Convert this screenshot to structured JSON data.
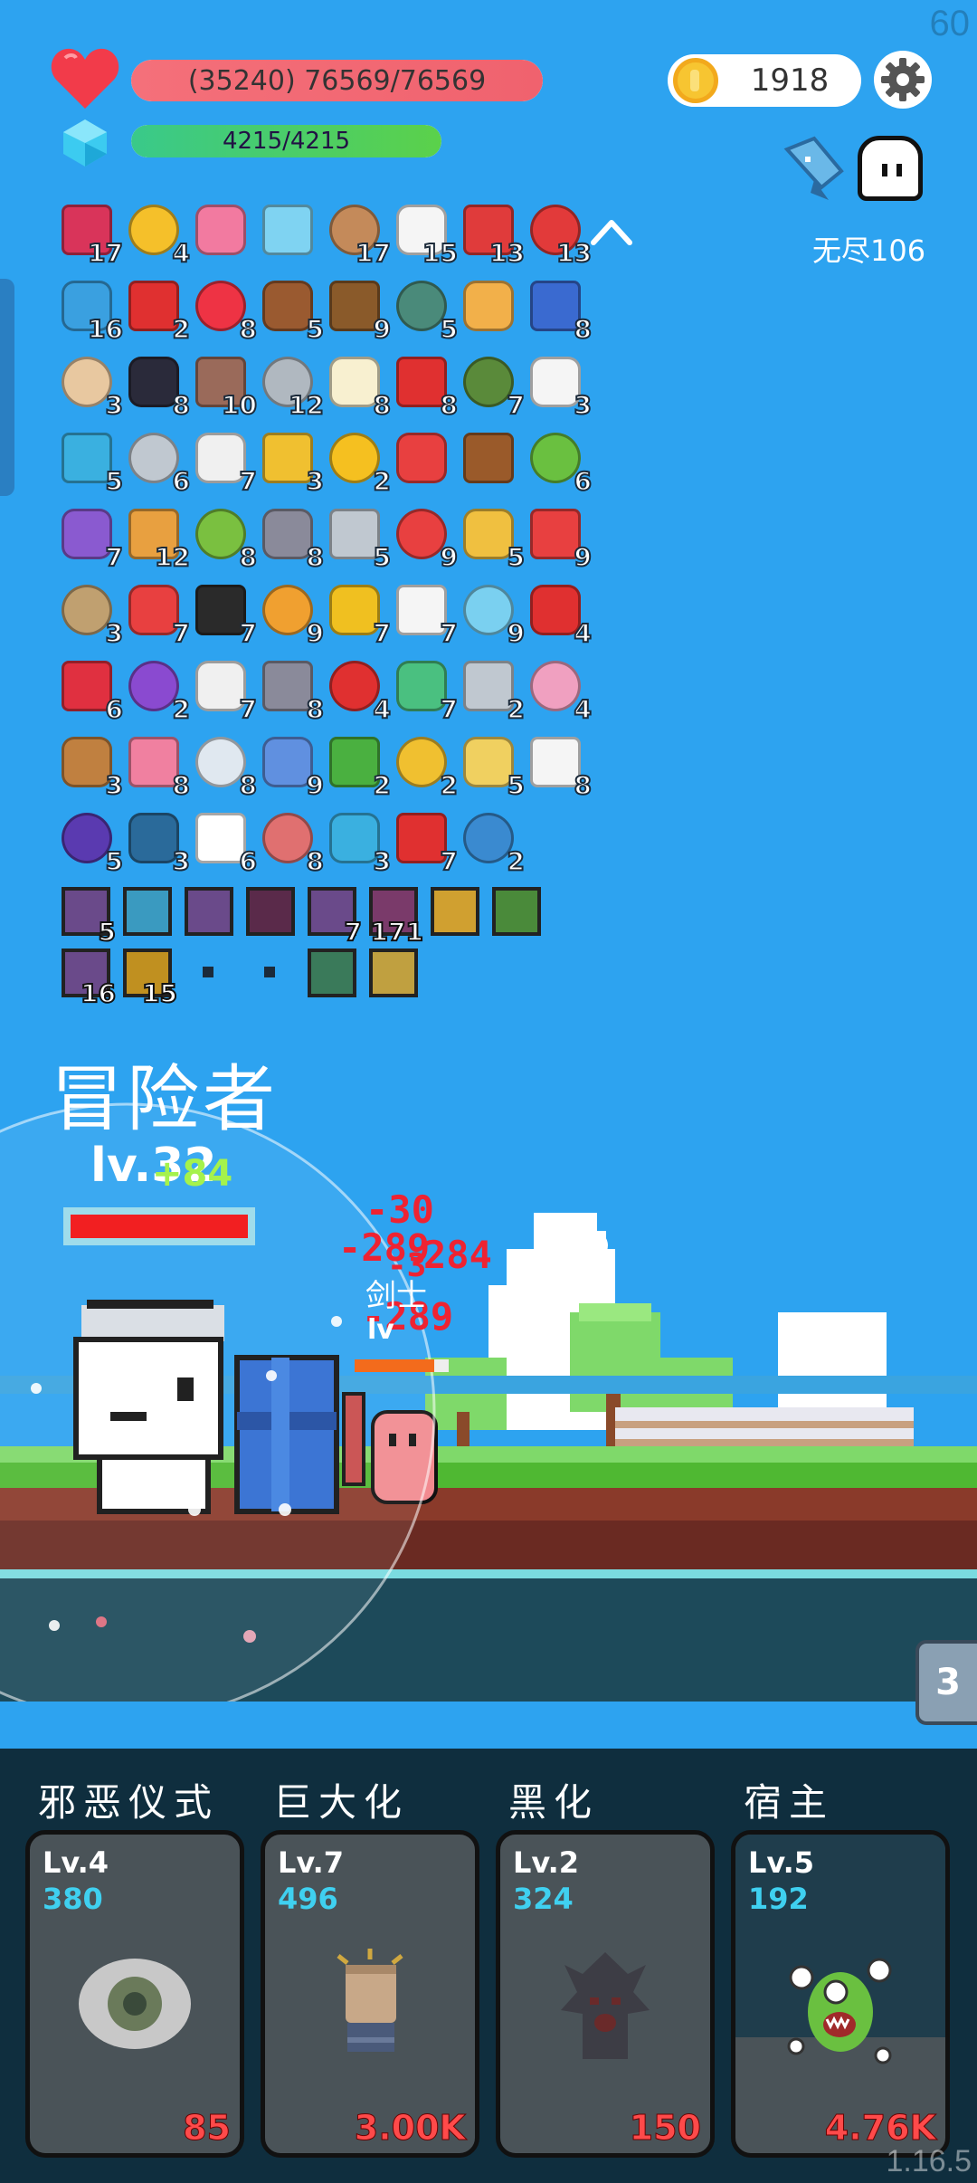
{
  "fps": "60",
  "version": "1.16.5",
  "hud": {
    "hp_text": "(35240) 76569/76569",
    "hp_fraction": 1.0,
    "mp_text": "4215/4215",
    "mp_fraction": 1.0,
    "coins": "1918",
    "endless_label": "无尽106"
  },
  "items": [
    {
      "icon": "jam-jar-icon",
      "count": "17",
      "color": "#d9345a"
    },
    {
      "icon": "crown-icon",
      "count": "4",
      "color": "#f5c02a"
    },
    {
      "icon": "love-letter-icon",
      "count": "",
      "color": "#f27aa0"
    },
    {
      "icon": "magnifier-icon",
      "count": "",
      "color": "#7fd3f2"
    },
    {
      "icon": "shield-round-icon",
      "count": "17",
      "color": "#c48a5a"
    },
    {
      "icon": "flower-icon",
      "count": "15",
      "color": "#f5f5f5"
    },
    {
      "icon": "sock-icon",
      "count": "13",
      "color": "#e03b3b"
    },
    {
      "icon": "apple-icon",
      "count": "13",
      "color": "#e23a3a"
    },
    {
      "icon": "star-card-icon",
      "count": "16",
      "color": "#3aa0e0"
    },
    {
      "icon": "magnet-icon",
      "count": "2",
      "color": "#e03030"
    },
    {
      "icon": "heart-icon",
      "count": "8",
      "color": "#ee3344"
    },
    {
      "icon": "cupcake-icon",
      "count": "5",
      "color": "#9a5a30"
    },
    {
      "icon": "coconut-icon",
      "count": "9",
      "color": "#8a5a2a"
    },
    {
      "icon": "target-disc-icon",
      "count": "5",
      "color": "#4a8a7a"
    },
    {
      "icon": "ticket-icon",
      "count": "",
      "color": "#f2b04a"
    },
    {
      "icon": "shield-blue-icon",
      "count": "8",
      "color": "#3a6ad0"
    },
    {
      "icon": "fist-icon",
      "count": "3",
      "color": "#e8c8a0"
    },
    {
      "icon": "bat-icon",
      "count": "8",
      "color": "#2a2a3a"
    },
    {
      "icon": "tombstone-icon",
      "count": "10",
      "color": "#9a6a5a"
    },
    {
      "icon": "sword-icon",
      "count": "12",
      "color": "#b0b8c0"
    },
    {
      "icon": "fried-egg-icon",
      "count": "8",
      "color": "#f8f0d0"
    },
    {
      "icon": "bookmark-icon",
      "count": "8",
      "color": "#e03030"
    },
    {
      "icon": "grenade-icon",
      "count": "7",
      "color": "#5a8a3a"
    },
    {
      "icon": "playing-card-icon",
      "count": "3",
      "color": "#f5f5f5"
    },
    {
      "icon": "scroll-icon",
      "count": "5",
      "color": "#3ab0e0"
    },
    {
      "icon": "compass-icon",
      "count": "6",
      "color": "#c0c8d0"
    },
    {
      "icon": "clipboard-icon",
      "count": "7",
      "color": "#f0f0f0"
    },
    {
      "icon": "ring-icon",
      "count": "3",
      "color": "#f0c030"
    },
    {
      "icon": "sun-bulb-icon",
      "count": "2",
      "color": "#f5c020"
    },
    {
      "icon": "discount-tag-icon",
      "count": "",
      "color": "#e84040"
    },
    {
      "icon": "treasure-chest-icon",
      "count": "",
      "color": "#9a5a2a"
    },
    {
      "icon": "slime-monster-icon",
      "count": "6",
      "color": "#6ac040"
    },
    {
      "icon": "star-shield-icon",
      "count": "7",
      "color": "#8a5ad0"
    },
    {
      "icon": "parchment-icon",
      "count": "12",
      "color": "#e8a040"
    },
    {
      "icon": "lime-icon",
      "count": "8",
      "color": "#7ac040"
    },
    {
      "icon": "spiked-mace-icon",
      "count": "8",
      "color": "#8a8a9a"
    },
    {
      "icon": "meteor-icon",
      "count": "5",
      "color": "#c0c8d0"
    },
    {
      "icon": "watermelon-icon",
      "count": "9",
      "color": "#e84040"
    },
    {
      "icon": "halo-wings-icon",
      "count": "5",
      "color": "#f0c040"
    },
    {
      "icon": "gift-box-icon",
      "count": "9",
      "color": "#e84040"
    },
    {
      "icon": "noose-icon",
      "count": "3",
      "color": "#c0a070"
    },
    {
      "icon": "pill-capsule-icon",
      "count": "7",
      "color": "#e84040"
    },
    {
      "icon": "cauldron-icon",
      "count": "7",
      "color": "#2a2a2a"
    },
    {
      "icon": "spellbook-icon",
      "count": "9",
      "color": "#f0a030"
    },
    {
      "icon": "sunflower-icon",
      "count": "7",
      "color": "#f0c020"
    },
    {
      "icon": "cloud-icon",
      "count": "7",
      "color": "#f5f5f5"
    },
    {
      "icon": "potion-flask-icon",
      "count": "9",
      "color": "#7ad0f0"
    },
    {
      "icon": "red-shield-icon",
      "count": "4",
      "color": "#e03030"
    },
    {
      "icon": "strawberry-icon",
      "count": "6",
      "color": "#e03040"
    },
    {
      "icon": "crystal-ball-icon",
      "count": "2",
      "color": "#8a4ad0"
    },
    {
      "icon": "envelope-icon",
      "count": "7",
      "color": "#f0f0f0"
    },
    {
      "icon": "battle-axe-icon",
      "count": "8",
      "color": "#8a8a9a"
    },
    {
      "icon": "mushroom-icon",
      "count": "4",
      "color": "#e03030"
    },
    {
      "icon": "green-idol-icon",
      "count": "7",
      "color": "#4ac080"
    },
    {
      "icon": "hook-icon",
      "count": "2",
      "color": "#c0c8d0"
    },
    {
      "icon": "ice-cream-icon",
      "count": "4",
      "color": "#f0a0c0"
    },
    {
      "icon": "bow-icon",
      "count": "3",
      "color": "#c08040"
    },
    {
      "icon": "perfume-icon",
      "count": "8",
      "color": "#f080a0"
    },
    {
      "icon": "light-bulb-icon",
      "count": "8",
      "color": "#e0e8f0"
    },
    {
      "icon": "blue-pill-icon",
      "count": "9",
      "color": "#6090e0"
    },
    {
      "icon": "cash-heart-icon",
      "count": "2",
      "color": "#4ab040"
    },
    {
      "icon": "magic-wand-icon",
      "count": "2",
      "color": "#f0c030"
    },
    {
      "icon": "treasure-map-icon",
      "count": "5",
      "color": "#f0d060"
    },
    {
      "icon": "dice-icon",
      "count": "8",
      "color": "#f5f5f5"
    },
    {
      "icon": "purple-hat-icon",
      "count": "5",
      "color": "#5a3ab0"
    },
    {
      "icon": "speech-bubble-icon",
      "count": "3",
      "color": "#2a6a9a"
    },
    {
      "icon": "ghost-icon",
      "count": "6",
      "color": "#ffffff"
    },
    {
      "icon": "steak-icon",
      "count": "8",
      "color": "#e07070"
    },
    {
      "icon": "blue-gem-icon",
      "count": "3",
      "color": "#3ab0e0"
    },
    {
      "icon": "thermometer-icon",
      "count": "7",
      "color": "#e03030"
    },
    {
      "icon": "crosshair-icon",
      "count": "2",
      "color": "#3a8ad0"
    }
  ],
  "skills": [
    {
      "icon": "slash-skill-icon",
      "count": "5",
      "color": "#6a4a8a"
    },
    {
      "icon": "light-burst-skill-icon",
      "count": "",
      "color": "#3a9ac0"
    },
    {
      "icon": "blade-skill-icon",
      "count": "",
      "color": "#6a4a8a"
    },
    {
      "icon": "demon-skill-icon",
      "count": "",
      "color": "#5a2a4a"
    },
    {
      "icon": "sword-rain-skill-icon",
      "count": "7",
      "color": "#6a4a8a"
    },
    {
      "icon": "fortress-skill-icon",
      "count": "171",
      "color": "#7a3a6a"
    },
    {
      "icon": "dark-gold-skill-icon",
      "count": "",
      "color": "#d0a030"
    },
    {
      "icon": "leaf-skill-icon",
      "count": "",
      "color": "#4a8a3a"
    },
    {
      "icon": "slash-skill-2-icon",
      "count": "16",
      "color": "#6a4a8a"
    },
    {
      "icon": "gold-mask-skill-icon",
      "count": "15",
      "color": "#c09020"
    },
    {
      "icon": "empty-slot-icon",
      "count": "",
      "color": ""
    },
    {
      "icon": "empty-slot-icon",
      "count": "",
      "color": ""
    },
    {
      "icon": "castle-skill-icon",
      "count": "",
      "color": "#3a7a5a"
    },
    {
      "icon": "shield-skill-icon",
      "count": "",
      "color": "#c0a040"
    }
  ],
  "battle": {
    "class_title": "冒险者",
    "player_level": "lv.32",
    "player_level_bonus": "+84",
    "player_hp_fraction": 1.0,
    "damage_numbers": [
      "-30",
      "-289",
      "-3",
      "284",
      "-289"
    ],
    "enemy_name": "剑士",
    "enemy_level": "lv",
    "enemy_hp_fraction": 0.85,
    "wave": "3"
  },
  "cards": [
    {
      "title": "邪恶仪式",
      "level": "Lv.4",
      "value": "380",
      "cost": "85",
      "art": "evil-eye-icon"
    },
    {
      "title": "巨大化",
      "level": "Lv.7",
      "value": "496",
      "cost": "3.00K",
      "art": "giant-fist-icon"
    },
    {
      "title": "黑化",
      "level": "Lv.2",
      "value": "324",
      "cost": "150",
      "art": "dark-tree-icon"
    },
    {
      "title": "宿主",
      "level": "Lv.5",
      "value": "192",
      "cost": "4.76K",
      "art": "parasite-monster-icon"
    }
  ],
  "colors": {
    "sky": "#2da3f0",
    "grass": "#5dc63a",
    "dirt": "#8a3a2a",
    "water": "#1d5a6a",
    "card_bg": "#0f2e3e"
  }
}
